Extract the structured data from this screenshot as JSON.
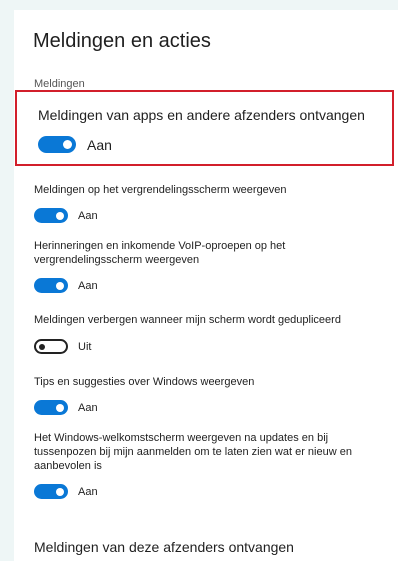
{
  "page": {
    "title": "Meldingen en acties",
    "section_label": "Meldingen"
  },
  "settings": [
    {
      "label": "Meldingen van apps en andere afzenders ontvangen",
      "state": "Aan",
      "on": true
    },
    {
      "label": "Meldingen op het vergrendelingsscherm weergeven",
      "state": "Aan",
      "on": true
    },
    {
      "label": "Herinneringen en inkomende VoIP-oproepen op het vergrendelingsscherm weergeven",
      "state": "Aan",
      "on": true
    },
    {
      "label": "Meldingen verbergen wanneer mijn scherm wordt gedupliceerd",
      "state": "Uit",
      "on": false
    },
    {
      "label": "Tips en suggesties over Windows weergeven",
      "state": "Aan",
      "on": true
    },
    {
      "label": "Het Windows-welkomstscherm weergeven na updates en bij tussenpozen bij mijn aanmelden om te laten zien wat er nieuw en aanbevolen is",
      "state": "Aan",
      "on": true
    }
  ],
  "senders_heading": "Meldingen van deze afzenders ontvangen",
  "colors": {
    "toggle_on": "#0a78d6",
    "highlight_border": "#d21f2b",
    "background": "#eef6f6"
  }
}
